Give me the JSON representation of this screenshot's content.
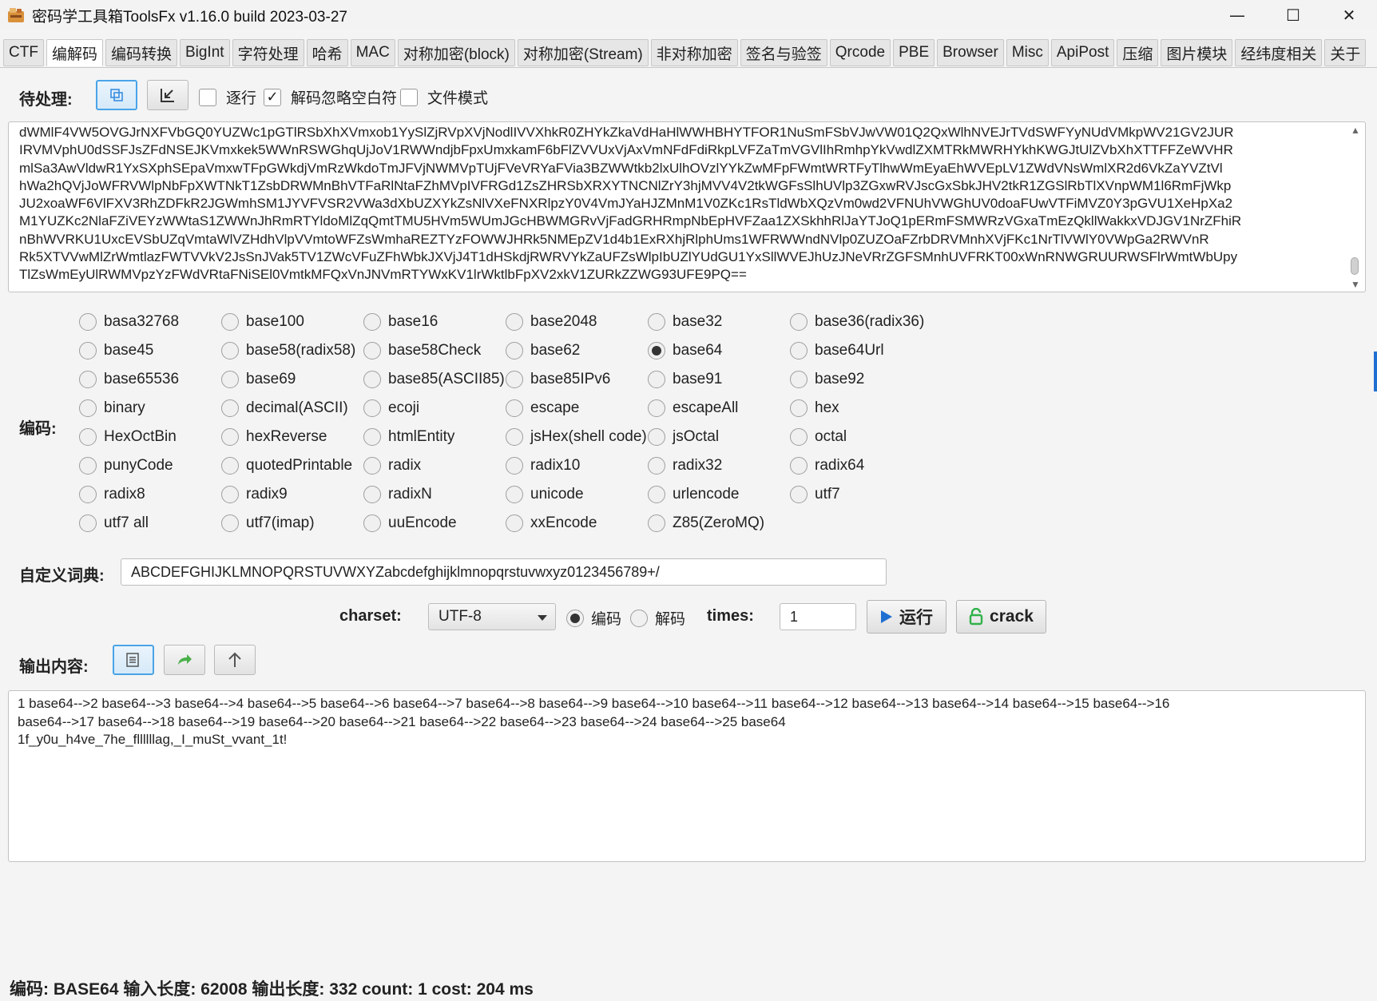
{
  "window": {
    "title": "密码学工具箱ToolsFx v1.16.0 build 2023-03-27",
    "controls": [
      "—",
      "☐",
      "✕"
    ]
  },
  "tabs": [
    {
      "label": "CTF"
    },
    {
      "label": "编解码",
      "active": true
    },
    {
      "label": "编码转换"
    },
    {
      "label": "BigInt"
    },
    {
      "label": "字符处理"
    },
    {
      "label": "哈希"
    },
    {
      "label": "MAC"
    },
    {
      "label": "对称加密(block)"
    },
    {
      "label": "对称加密(Stream)"
    },
    {
      "label": "非对称加密"
    },
    {
      "label": "签名与验签"
    },
    {
      "label": "Qrcode"
    },
    {
      "label": "PBE"
    },
    {
      "label": "Browser"
    },
    {
      "label": "Misc"
    },
    {
      "label": "ApiPost"
    },
    {
      "label": "压缩"
    },
    {
      "label": "图片模块"
    },
    {
      "label": "经纬度相关"
    },
    {
      "label": "关于"
    }
  ],
  "input": {
    "label": "待处理:",
    "options": [
      {
        "label": "逐行",
        "checked": false
      },
      {
        "label": "解码忽略空白符",
        "checked": true
      },
      {
        "label": "文件模式",
        "checked": false
      }
    ],
    "text": "dWMlF4VW5OVGJrNXFVbGQ0YUZWc1pGTlRSbXhXVmxob1YySlZjRVpXVjNodlIVVXhkR0ZHYkZkaVdHaHlWWHBHYTFOR1NuSmFSbVJwVW01Q2QxWlhNVEJrTVdSWFYyNUdVMkpWV21GV2JUR\nIRVMVphU0dSSFJsZFdNSEJKVmxkek5WWnRSWGhqUjJoV1RWWndjbFpxUmxkamF6bFlZVVUxVjAxVmNFdFdiRkpLVFZaTmVGVlIhRmhpYkVwdlZXMTRkMWRHYkhKWGJtUlZVbXhXTTFFZeWVHR\nmlSa3AwVldwR1YxSXphSEpaVmxwTFpGWkdjVmRzWkdoTmJFVjNWMVpTUjFVeVRYaFVia3BZWWtkb2lxUlhOVzlYYkZwMFpFWmtWRTFyTlhwWmEyaEhWVEpLV1ZWdVNsWmlXR2d6VkZaYVZtVl\nhWa2hQVjJoWFRVWlpNbFpXWTNkT1ZsbDRWMnBhVTFaRlNtaFZhMVpIVFRGd1ZsZHRSbXRXYTNCNlZrY3hjMVV4V2tkWGFsSlhUVlp3ZGxwRVJscGxSbkJHV2tkR1ZGSlRbTlXVnpWM1l6RmFjWkp\nJU2xoaWF6VlFXV3RhZDFkR2JGWmhSM1JYVFVSR2VWa3dXbUZXYkZsNlVXeFNXRlpzY0V4VmJYaHJZMnM1V0ZKc1RsTldWbXQzVm0wd2VFNUhVWGhUV0doaFUwVTFiMVZ0Y3pGVU1XeHpXa2\nM1YUZKc2NlaFZiVEYzWWtaS1ZWWnJhRmRTYldoMlZqQmtTMU5HVm5WUmJGcHBWMGRvVjFadGRHRmpNbEpHVFZaa1ZXSkhhRlJaYTJoQ1pERmFSMWRzVGxaTmEzQkllWakkxVDJGV1NrZFhiR\nnBhWVRKU1UxcEVSbUZqVmtaWlVZHdhVlpVVmtoWFZsWmhaREZTYzFOWWJHRk5NMEpZV1d4b1ExRXhjRlphUms1WFRWWndNVlp0ZUZOaFZrbDRVMnhXVjFKc1NrTlVWlY0VWpGa2RWVnR\nRk5XTVVwMlZrWmtlazFWTVVkV2JsSnJVak5TV1ZWcVFuZFhWbkJXVjJ4T1dHSkdjRWRVYkZaUFZsWlpIbUZlYUdGU1YxSllWVEJhUzJNeVRrZGFSMnhUVFRKT00xWnRNWGRUURWSFlrWmtWbUpy\nTlZsWmEyUlRWMVpzYzFWdVRtaFNiSEl0VmtkMFQxVnJNVmRTYWxKV1lrWktlbFpXV2xkV1ZURkZZWG93UFE9PQ=="
  },
  "encoding": {
    "label": "编码:",
    "options": [
      [
        "basa32768",
        "base100",
        "base16",
        "base2048",
        "base32",
        "base36(radix36)"
      ],
      [
        "base45",
        "base58(radix58)",
        "base58Check",
        "base62",
        "base64",
        "base64Url"
      ],
      [
        "base65536",
        "base69",
        "base85(ASCII85)",
        "base85IPv6",
        "base91",
        "base92"
      ],
      [
        "binary",
        "decimal(ASCII)",
        "ecoji",
        "escape",
        "escapeAll",
        "hex"
      ],
      [
        "HexOctBin",
        "hexReverse",
        "htmlEntity",
        "jsHex(shell code)",
        "jsOctal",
        "octal"
      ],
      [
        "punyCode",
        "quotedPrintable",
        "radix",
        "radix10",
        "radix32",
        "radix64"
      ],
      [
        "radix8",
        "radix9",
        "radixN",
        "unicode",
        "urlencode",
        "utf7"
      ],
      [
        "utf7 all",
        "utf7(imap)",
        "uuEncode",
        "xxEncode",
        "Z85(ZeroMQ)"
      ]
    ],
    "selected": "base64"
  },
  "dictionary": {
    "label": "自定义词典:",
    "value": "ABCDEFGHIJKLMNOPQRSTUVWXYZabcdefghijklmnopqrstuvwxyz0123456789+/"
  },
  "controls": {
    "charset_label": "charset:",
    "charset_value": "UTF-8",
    "mode_encode": "编码",
    "mode_decode": "解码",
    "mode_selected": "encode",
    "times_label": "times:",
    "times_value": "1",
    "run_label": "运行",
    "crack_label": "crack",
    "accent_color": "#1f6fd1",
    "crack_icon_color": "#2fb24a"
  },
  "output": {
    "label": "输出内容:",
    "text": "1 base64-->2 base64-->3 base64-->4 base64-->5 base64-->6 base64-->7 base64-->8 base64-->9 base64-->10 base64-->11 base64-->12 base64-->13 base64-->14 base64-->15 base64-->16\nbase64-->17 base64-->18 base64-->19 base64-->20 base64-->21 base64-->22 base64-->23 base64-->24 base64-->25 base64\n1f_y0u_h4ve_7he_fllllllag,_I_muSt_vvant_1t!"
  },
  "status": {
    "text": "编码: BASE64  输入长度: 62008  输出长度: 332 count: 1 cost: 204 ms"
  }
}
